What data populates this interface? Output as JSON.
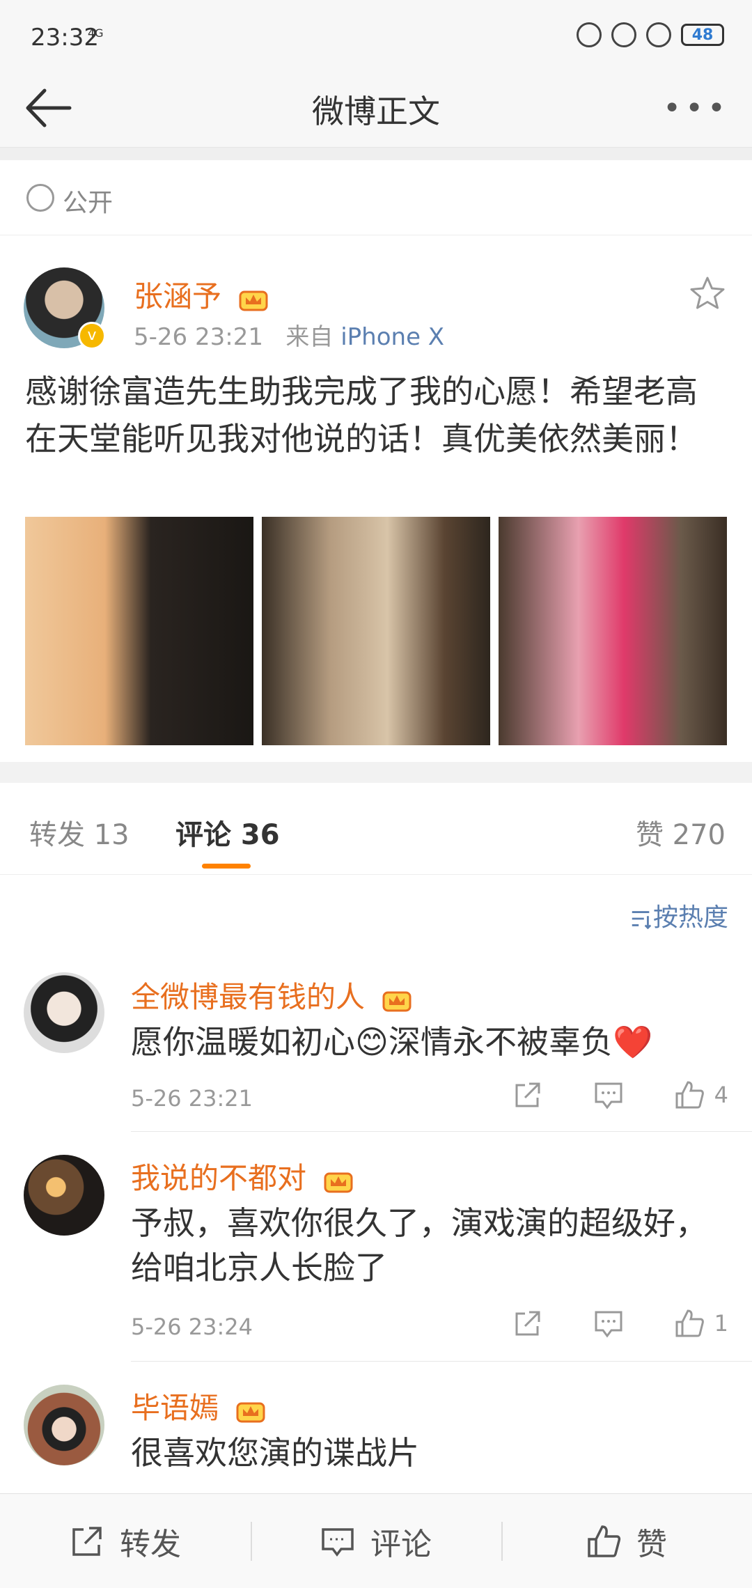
{
  "status": {
    "time": "23:32",
    "signal": "4G",
    "battery": "48"
  },
  "nav": {
    "title": "微博正文",
    "more": "•••"
  },
  "visibility": "公开",
  "post": {
    "author": "张涵予",
    "time": "5-26 23:21",
    "source_prefix": "来自",
    "source": "iPhone X",
    "text": "感谢徐富造先生助我完成了我的心愿！希望老高在天堂能听见我对他说的话！真优美依然美丽！"
  },
  "tabs": {
    "repost": "转发 13",
    "comment": "评论 36",
    "like": "赞 270"
  },
  "sort": "按热度",
  "comments": [
    {
      "name": "全微博最有钱的人",
      "text": "愿你温暖如初心😊深情永不被辜负❤️",
      "time": "5-26 23:21",
      "likes": "4"
    },
    {
      "name": "我说的不都对",
      "text": "予叔，喜欢你很久了，演戏演的超级好，给咱北京人长脸了",
      "time": "5-26 23:24",
      "likes": "1"
    },
    {
      "name": "毕语嫣",
      "text": "很喜欢您演的谍战片"
    }
  ],
  "bottom": {
    "repost": "转发",
    "comment": "评论",
    "like": "赞"
  },
  "colors": {
    "accent": "#ff8200",
    "username": "#e86f1f",
    "link": "#5b7fb0"
  }
}
